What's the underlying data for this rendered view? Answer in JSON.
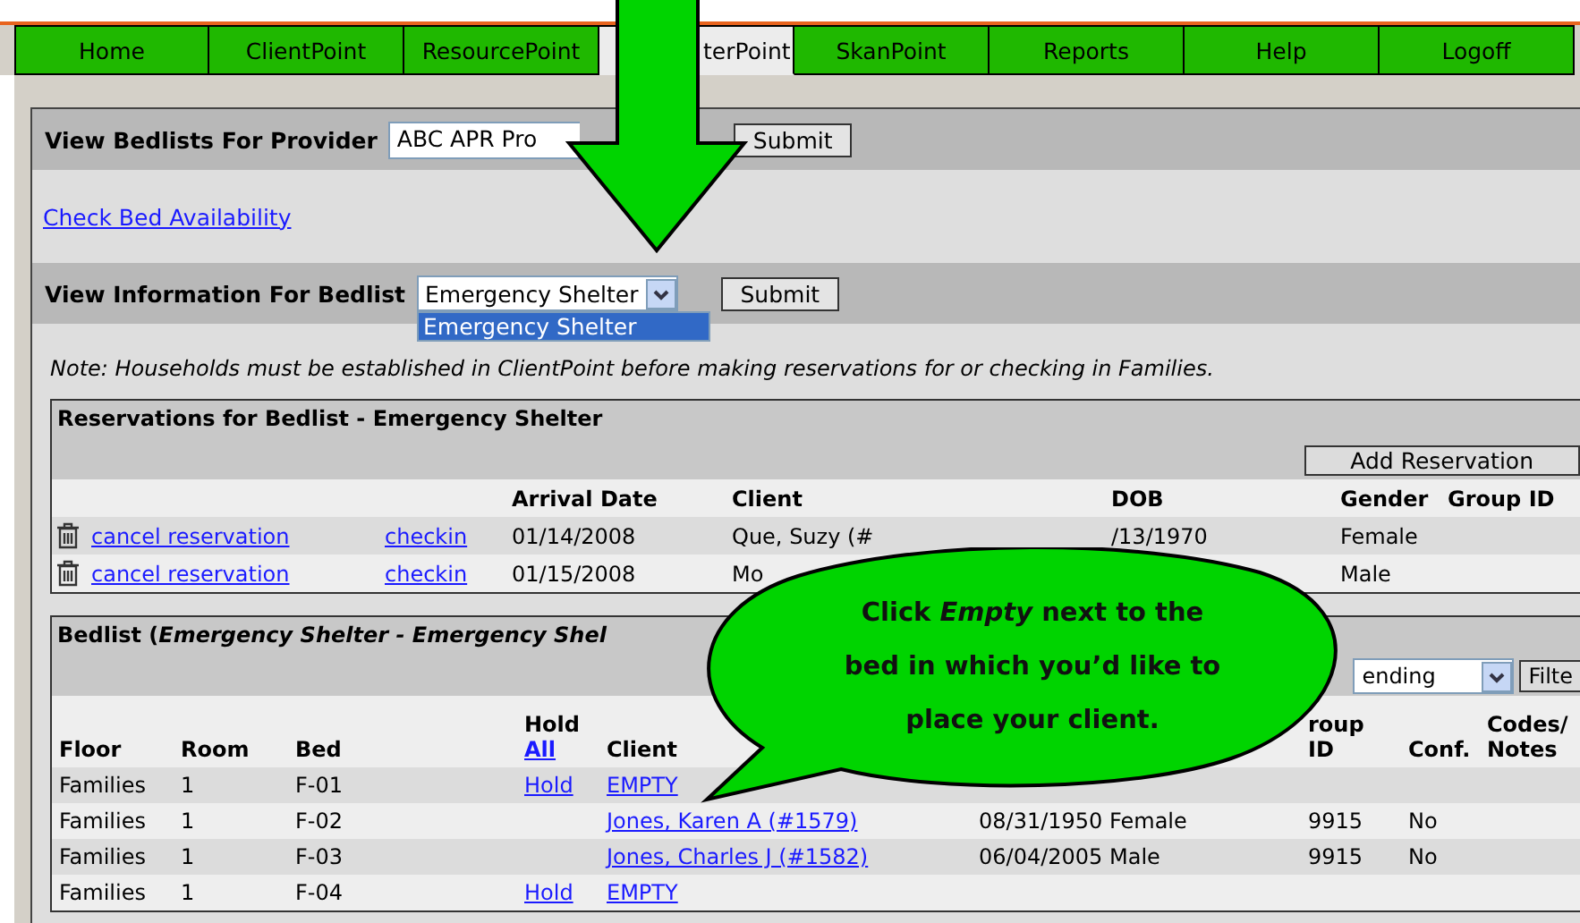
{
  "nav_tabs": [
    {
      "label": "Home",
      "selected": false
    },
    {
      "label": "ClientPoint",
      "selected": false
    },
    {
      "label": "ResourcePoint",
      "selected": false
    },
    {
      "label": "terPoint",
      "selected": true
    },
    {
      "label": "SkanPoint",
      "selected": false
    },
    {
      "label": "Reports",
      "selected": false
    },
    {
      "label": "Help",
      "selected": false
    },
    {
      "label": "Logoff",
      "selected": false
    }
  ],
  "provider": {
    "label": "View Bedlists For Provider",
    "value": "ABC APR Pro",
    "button": "Submit"
  },
  "check_link": "Check Bed Availability",
  "bedlist_select": {
    "label": "View Information For Bedlist",
    "value": "Emergency Shelter",
    "button": "Submit",
    "options": [
      {
        "label": "Emergency Shelter",
        "selected": true
      }
    ]
  },
  "note": "Note: Households must be established in ClientPoint before making reservations for or checking in Families.",
  "reservations": {
    "title": "Reservations for Bedlist - Emergency Shelter",
    "add_button": "Add Reservation",
    "columns": [
      "Arrival Date",
      "Client",
      "DOB",
      "Gender",
      "Group ID"
    ],
    "rows": [
      {
        "cancel": "cancel reservation",
        "checkin": "checkin",
        "arrival": "01/14/2008",
        "client": "Que, Suzy (#",
        "dob": "/13/1970",
        "gender": "Female"
      },
      {
        "cancel": "cancel reservation",
        "checkin": "checkin",
        "arrival": "01/15/2008",
        "client": "Mo",
        "gender": "Male"
      }
    ]
  },
  "bedlist": {
    "title": "Bedlist (*Emergency Shelter - Emergency Shel*",
    "sort_value": "ending",
    "filter_button": "Filte",
    "columns": [
      {
        "label": "Floor"
      },
      {
        "label": "Room"
      },
      {
        "label": "Bed"
      },
      {
        "label": "Hold",
        "link": "All"
      },
      {
        "label": "Client"
      },
      null,
      null,
      {
        "label": "roup ID"
      },
      {
        "label": "Conf."
      },
      {
        "label": "Codes/ Notes"
      }
    ],
    "rows": [
      {
        "floor": "Families",
        "room": "1",
        "bed": "F-01",
        "hold": "Hold",
        "client": "EMPTY"
      },
      {
        "floor": "Families",
        "room": "1",
        "bed": "F-02",
        "client": "Jones, Karen A (#1579)",
        "dob": "08/31/1950",
        "gender": "Female",
        "group_id": "9915",
        "conf": "No"
      },
      {
        "floor": "Families",
        "room": "1",
        "bed": "F-03",
        "client": "Jones, Charles J (#1582)",
        "dob": "06/04/2005",
        "gender": "Male",
        "group_id": "9915",
        "conf": "No"
      },
      {
        "floor": "Families",
        "room": "1",
        "bed": "F-04",
        "hold": "Hold",
        "client": "EMPTY"
      }
    ]
  },
  "callout": {
    "text": "Click *Empty* next to the\nbed in which you’d like to\nplace your client."
  }
}
